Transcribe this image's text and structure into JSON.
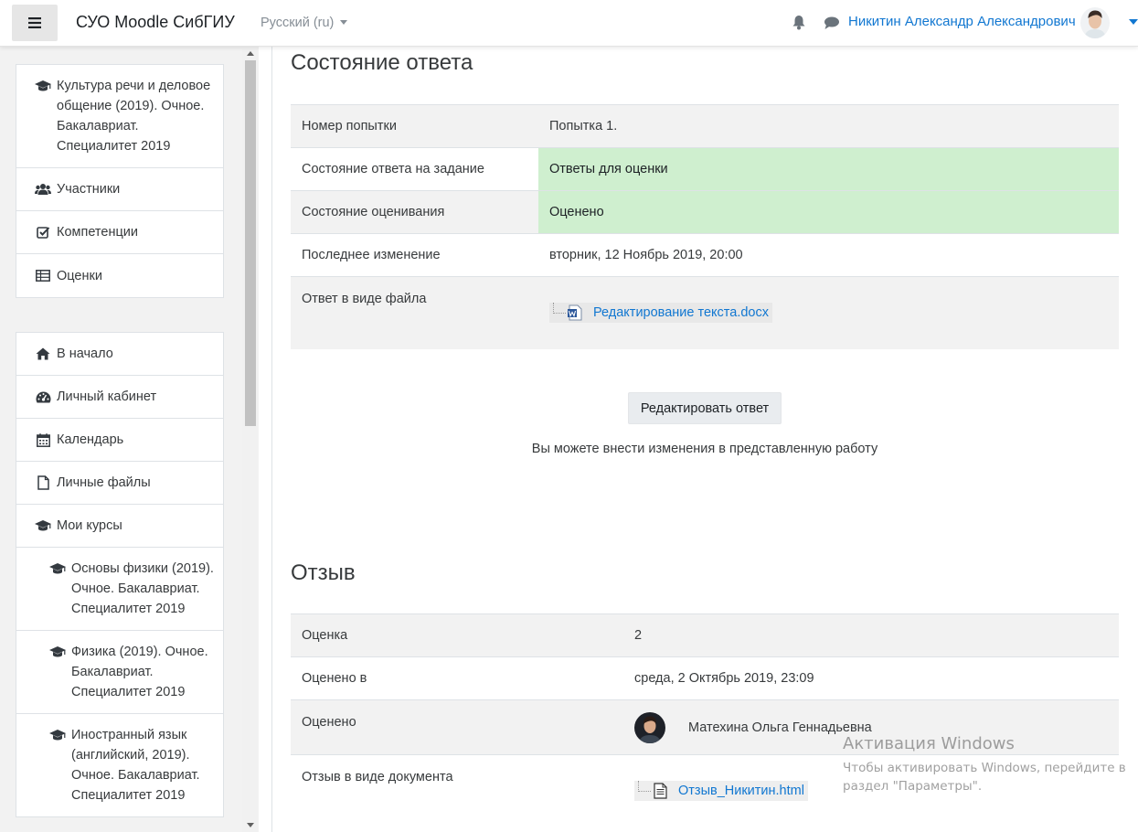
{
  "navbar": {
    "site_name": "СУО Moodle СибГИУ",
    "language": "Русский (ru)",
    "user_name": "Никитин Александр Александрович"
  },
  "sidebar": {
    "course_block": [
      {
        "label": "Культура речи и деловое общение (2019). Очное. Бакалавриат. Специалитет 2019",
        "icon": "graduation-cap-icon"
      },
      {
        "label": "Участники",
        "icon": "users-icon"
      },
      {
        "label": "Компетенции",
        "icon": "checkbox-icon"
      },
      {
        "label": "Оценки",
        "icon": "table-icon"
      }
    ],
    "nav_block": [
      {
        "label": "В начало",
        "icon": "home-icon"
      },
      {
        "label": "Личный кабинет",
        "icon": "dashboard-icon"
      },
      {
        "label": "Календарь",
        "icon": "calendar-icon"
      },
      {
        "label": "Личные файлы",
        "icon": "file-icon"
      },
      {
        "label": "Мои курсы",
        "icon": "graduation-cap-icon"
      }
    ],
    "my_courses": [
      {
        "label": "Основы физики (2019). Очное. Бакалавриат. Специалитет 2019",
        "icon": "graduation-cap-icon"
      },
      {
        "label": "Физика (2019). Очное. Бакалавриат. Специалитет 2019",
        "icon": "graduation-cap-icon"
      },
      {
        "label": "Иностранный язык (английский, 2019). Очное. Бакалавриат. Специалитет 2019",
        "icon": "graduation-cap-icon"
      }
    ]
  },
  "submission": {
    "heading": "Состояние ответа",
    "rows": {
      "attempt_label": "Номер попытки",
      "attempt_value": "Попытка 1.",
      "status_label": "Состояние ответа на задание",
      "status_value": "Ответы для оценки",
      "grading_label": "Состояние оценивания",
      "grading_value": "Оценено",
      "modified_label": "Последнее изменение",
      "modified_value": "вторник, 12 Ноябрь 2019, 20:00",
      "file_label": "Ответ в виде файла",
      "file_name": "Редактирование текста.docx"
    },
    "edit_button": "Редактировать ответ",
    "edit_note": "Вы можете внести изменения в представленную работу",
    "status_color": "#cfefcf"
  },
  "feedback": {
    "heading": "Отзыв",
    "rows": {
      "grade_label": "Оценка",
      "grade_value": "2",
      "graded_on_label": "Оценено в",
      "graded_on_value": "среда, 2 Октябрь 2019, 23:09",
      "graded_by_label": "Оценено",
      "graded_by_value": "Матехина Ольга Геннадьевна",
      "doc_label": "Отзыв в виде документа",
      "doc_file": "Отзыв_Никитин.html"
    }
  },
  "watermark": {
    "title": "Активация Windows",
    "line1": "Чтобы активировать Windows, перейдите в",
    "line2": "раздел \"Параметры\"."
  }
}
